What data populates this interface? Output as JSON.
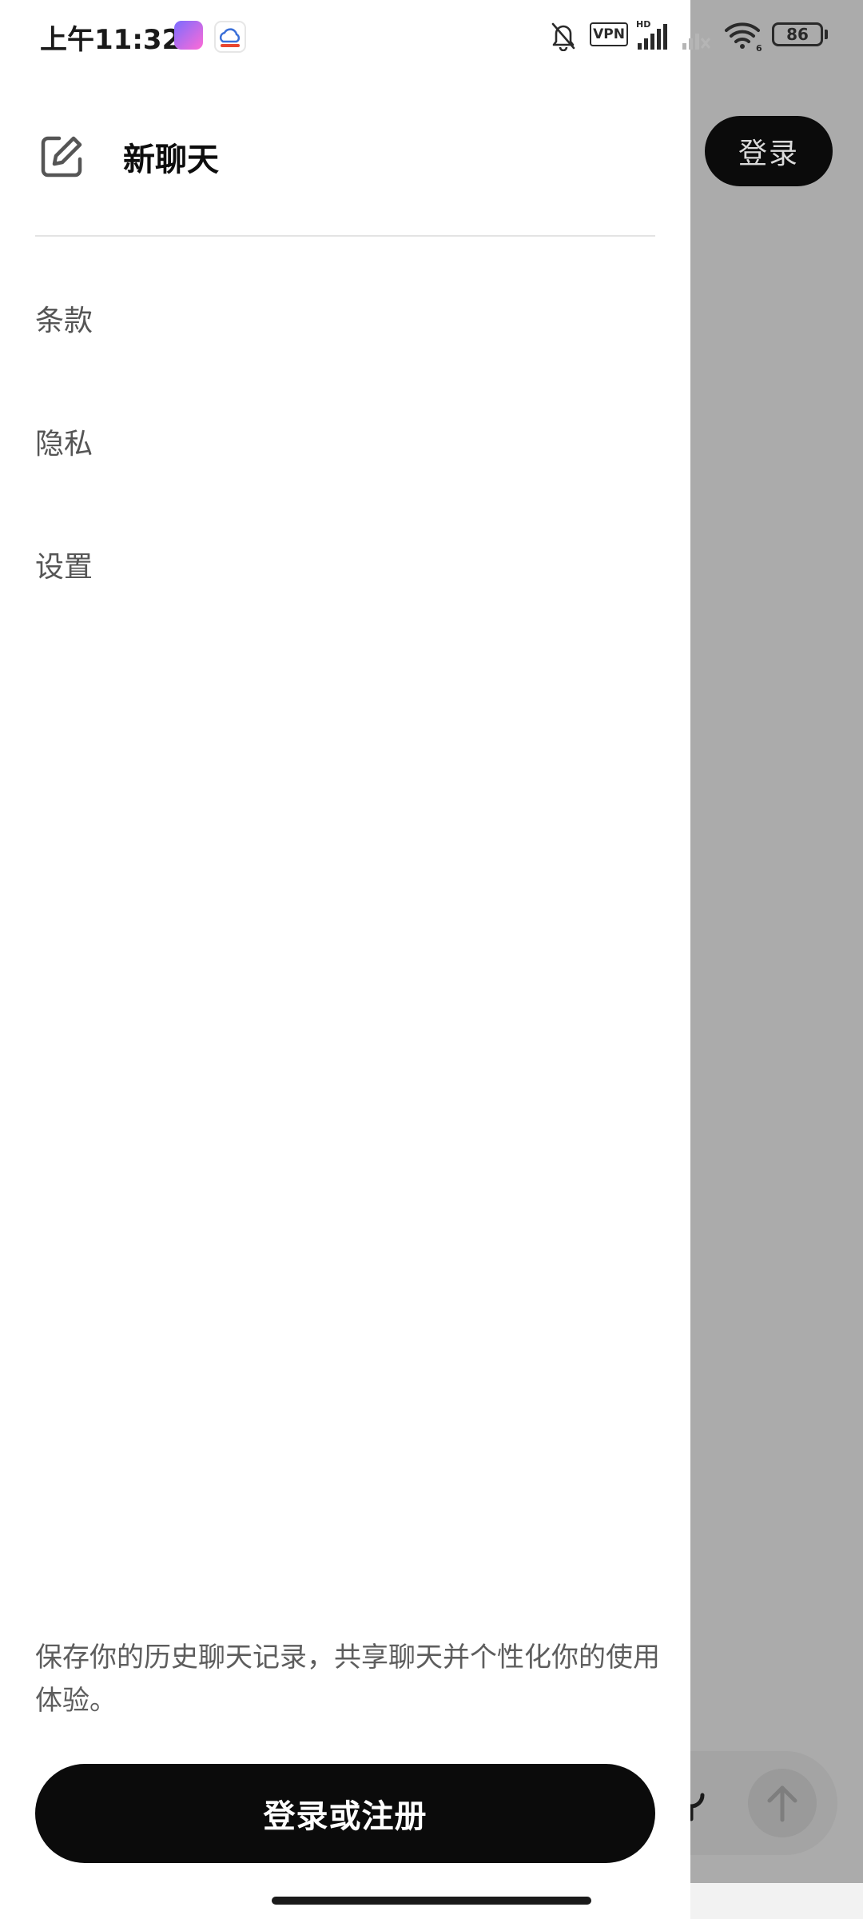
{
  "status_bar": {
    "time": "上午11:32",
    "vpn": "VPN",
    "battery": "86",
    "network_hd": "HD",
    "wifi_badge": "6"
  },
  "background": {
    "login_label": "登录"
  },
  "drawer": {
    "new_chat_label": "新聊天",
    "menu": [
      {
        "label": "条款"
      },
      {
        "label": "隐私"
      },
      {
        "label": "设置"
      }
    ],
    "footer_note": "保存你的历史聊天记录，共享聊天并个性化你的使用体验。",
    "login_signup_label": "登录或注册"
  },
  "colors": {
    "primary_button": "#0b0b0b",
    "overlay": "#ababab",
    "drawer_bg": "#ffffff",
    "menu_text": "#555555"
  },
  "icons": {
    "new_chat": "edit-square-icon",
    "mute": "bell-off-icon",
    "wifi": "wifi-icon",
    "signal": "cellular-signal-icon",
    "mic": "microphone-icon",
    "send": "arrow-up-icon"
  }
}
